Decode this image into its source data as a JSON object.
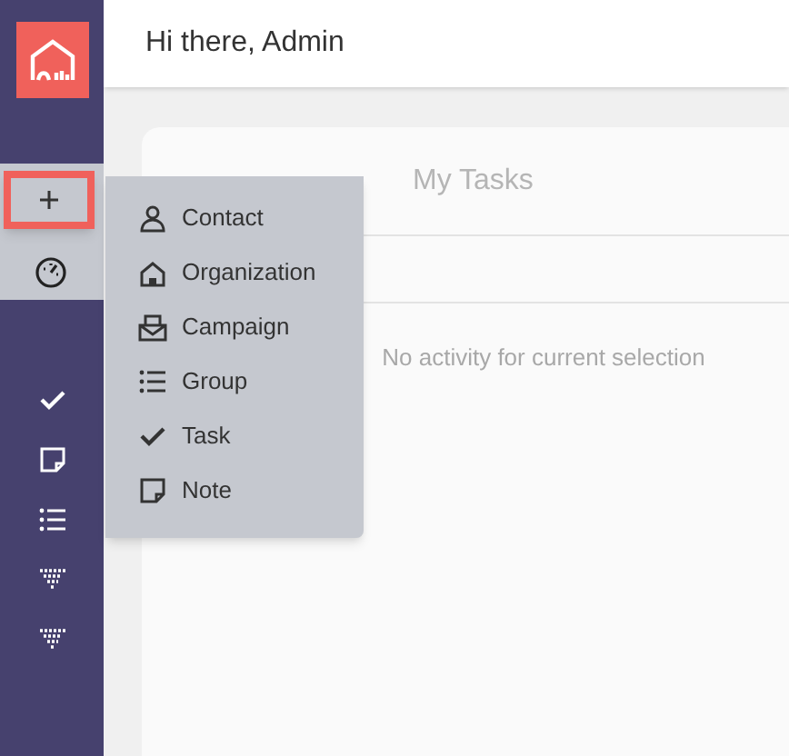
{
  "header": {
    "greeting": "Hi there, Admin"
  },
  "tabs": [
    {
      "label": "My Tasks",
      "selected": false
    }
  ],
  "empty_message": "No activity for current selection",
  "add_menu": {
    "open": true,
    "items": [
      {
        "kind": "person",
        "label": "Contact"
      },
      {
        "kind": "home",
        "label": "Organization"
      },
      {
        "kind": "mail",
        "label": "Campaign"
      },
      {
        "kind": "list",
        "label": "Group"
      },
      {
        "kind": "check",
        "label": "Task"
      },
      {
        "kind": "note",
        "label": "Note"
      }
    ]
  },
  "sidebar": {
    "items": [
      {
        "kind": "check"
      },
      {
        "kind": "note"
      },
      {
        "kind": "list"
      },
      {
        "kind": "funnel"
      },
      {
        "kind": "funnel"
      }
    ]
  }
}
